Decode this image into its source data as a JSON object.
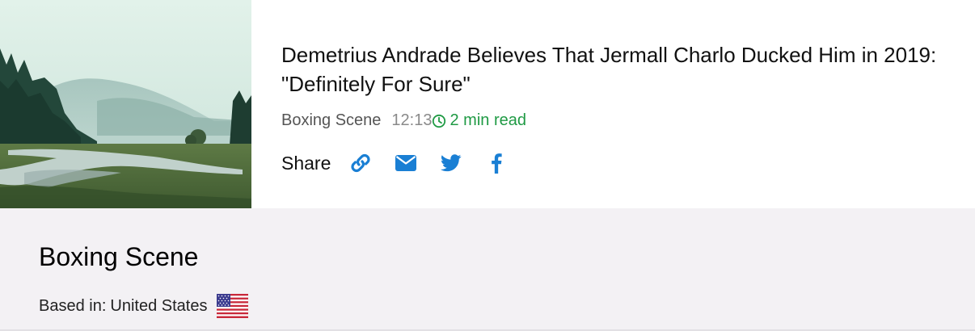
{
  "article": {
    "headline": "Demetrius Andrade Believes That Jermall Charlo Ducked Him in 2019: \"Definitely For Sure\"",
    "source": "Boxing Scene",
    "time": "12:13",
    "read_time": "2 min read",
    "thumbnail": "landscape-photo"
  },
  "share": {
    "label": "Share",
    "buttons": [
      {
        "icon": "link-icon"
      },
      {
        "icon": "email-icon"
      },
      {
        "icon": "twitter-icon"
      },
      {
        "icon": "facebook-icon"
      }
    ]
  },
  "source_panel": {
    "name": "Boxing Scene",
    "based_in_label": "Based in:",
    "country": "United States",
    "flag": "us-flag-icon"
  },
  "colors": {
    "accent_green": "#1f9a44",
    "share_blue": "#1a7fd4",
    "panel_bg": "#f3f1f4"
  }
}
